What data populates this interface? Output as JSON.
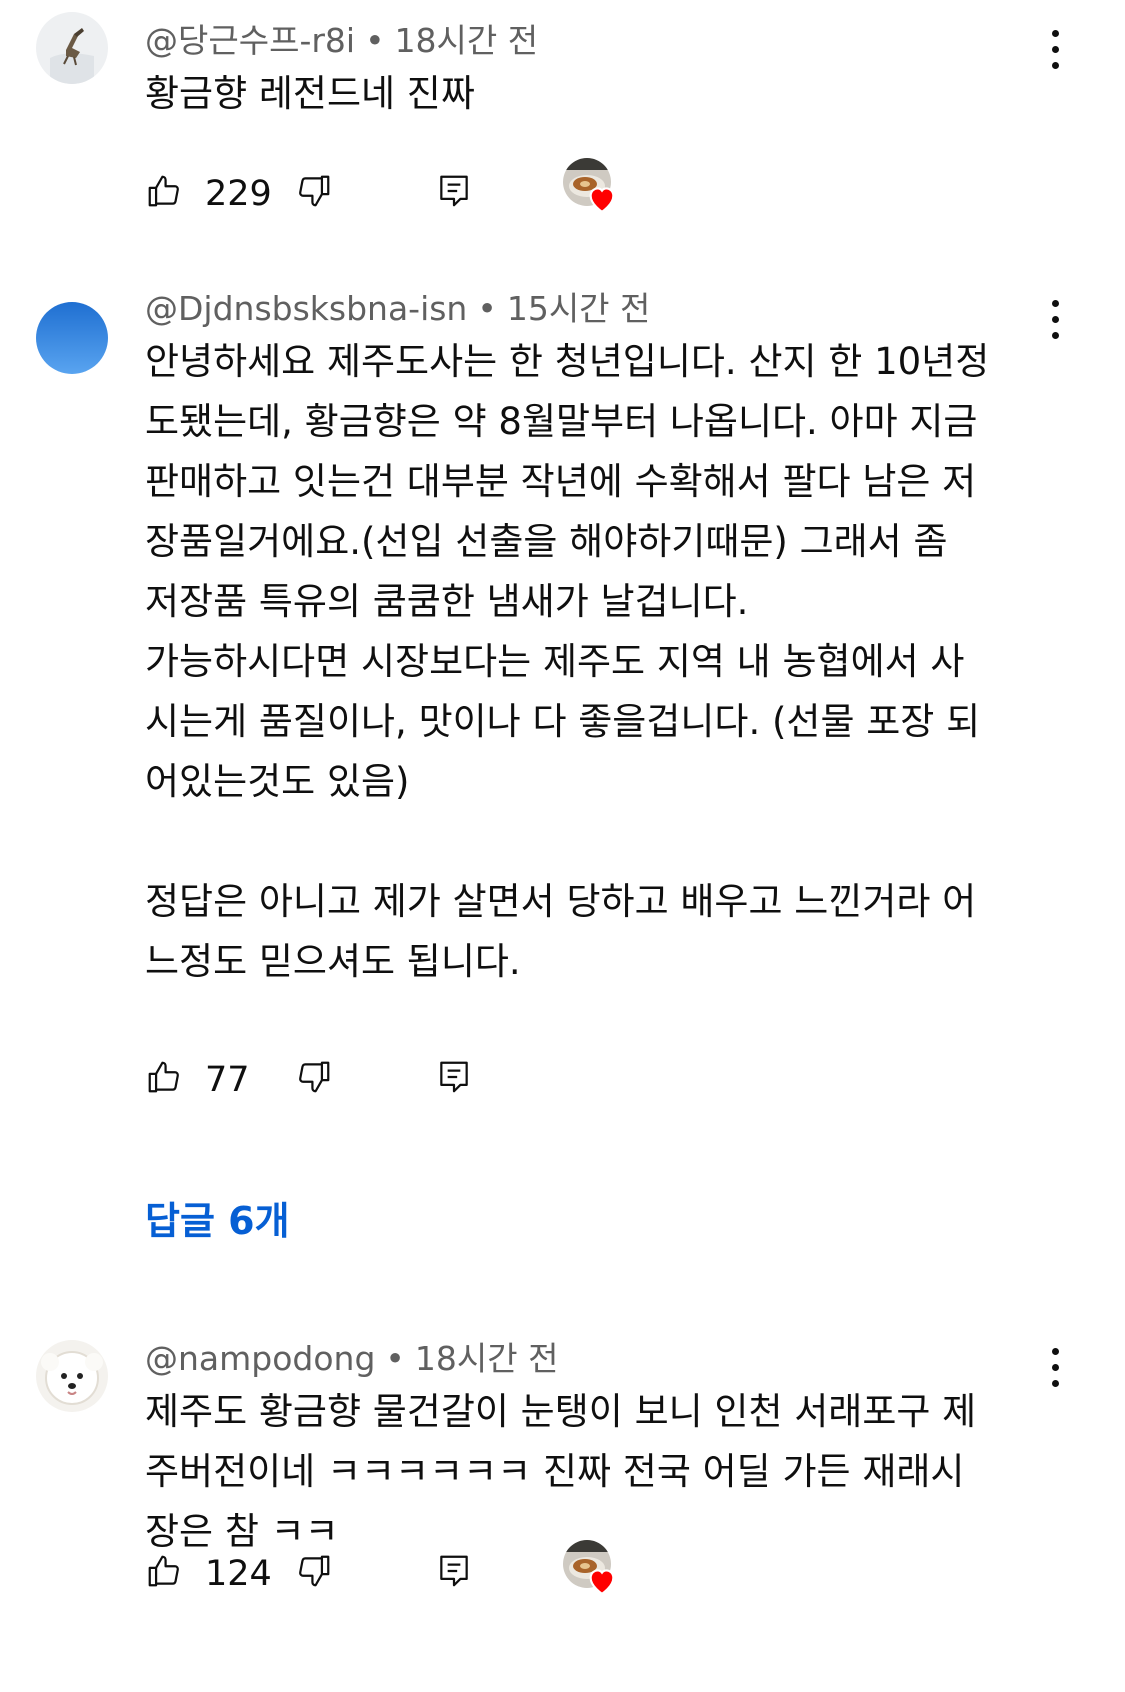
{
  "comments": [
    {
      "author": "@당근수프-r8i",
      "time": "18시간 전",
      "text": "황금향 레전드네 진짜",
      "likes": "229",
      "creator_hearted": true
    },
    {
      "author": "@Djdnsbsksbna-isn",
      "time": "15시간 전",
      "text": "안녕하세요 제주도사는 한 청년입니다. 산지 한 10년정\n도됐는데, 황금향은 약 8월말부터 나옵니다. 아마 지금\n판매하고 잇는건 대부분 작년에 수확해서 팔다 남은 저\n장품일거에요.(선입 선출을 해야하기때문) 그래서 좀\n저장품 특유의 쿰쿰한 냄새가 날겁니다.\n가능하시다면 시장보다는 제주도 지역 내 농협에서 사\n시는게 품질이나, 맛이나 다 좋을겁니다. (선물 포장 되\n어있는것도 있음)\n\n정답은 아니고 제가 살면서 당하고 배우고 느낀거라 어\n느정도 믿으셔도 됩니다.",
      "likes": "77",
      "creator_hearted": false,
      "replies_label": "답글 6개"
    },
    {
      "author": "@nampodong",
      "time": "18시간 전",
      "text": "제주도 황금향 물건갈이 눈탱이 보니 인천 서래포구 제\n주버전이네 ㅋㅋㅋㅋㅋㅋ 진짜 전국 어딜 가든 재래시\n장은 참 ㅋㅋ",
      "likes": "124",
      "creator_hearted": true
    }
  ],
  "icons": {
    "like": "thumbs-up-icon",
    "dislike": "thumbs-down-icon",
    "reply": "reply-icon",
    "more": "more-vertical-icon",
    "heart": "heart-icon"
  },
  "colors": {
    "link": "#065fd4",
    "heart": "#ff0000",
    "meta": "#606060"
  }
}
